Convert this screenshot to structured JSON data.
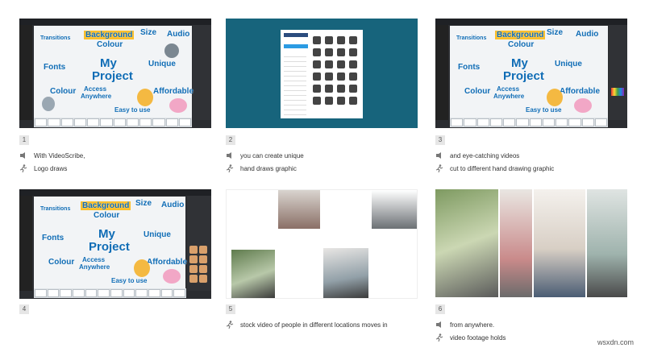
{
  "frames": [
    {
      "num": "1",
      "kind": "editor",
      "lines": [
        {
          "icon": "speaker-icon",
          "text": "With VideoScribe,"
        },
        {
          "icon": "running-figure-icon",
          "text": "Logo draws"
        }
      ]
    },
    {
      "num": "2",
      "kind": "image-picker",
      "lines": [
        {
          "icon": "speaker-icon",
          "text": "you can create unique"
        },
        {
          "icon": "running-figure-icon",
          "text": "hand draws graphic"
        }
      ]
    },
    {
      "num": "3",
      "kind": "editor",
      "lines": [
        {
          "icon": "speaker-icon",
          "text": "and eye-catching videos"
        },
        {
          "icon": "running-figure-icon",
          "text": "cut to different hand drawing graphic"
        }
      ]
    },
    {
      "num": "4",
      "kind": "editor",
      "lines": []
    },
    {
      "num": "5",
      "kind": "stock-photos",
      "lines": [
        {
          "icon": "running-figure-icon",
          "text": "stock video of people in different locations moves in"
        }
      ]
    },
    {
      "num": "6",
      "kind": "photo-collage",
      "lines": [
        {
          "icon": "speaker-icon",
          "text": "from anywhere."
        },
        {
          "icon": "running-figure-icon",
          "text": "video footage holds"
        }
      ]
    }
  ],
  "canvas_words": {
    "background": "Background",
    "colour": "Colour",
    "size": "Size",
    "audio": "Audio",
    "transitions": "Transitions",
    "fonts": "Fonts",
    "my": "My",
    "project": "Project",
    "unique": "Unique",
    "colour2": "Colour",
    "access": "Access",
    "anywhere": "Anywhere",
    "affordable": "Affordable",
    "easy": "Easy to use"
  },
  "watermark": "wsxdn.com"
}
